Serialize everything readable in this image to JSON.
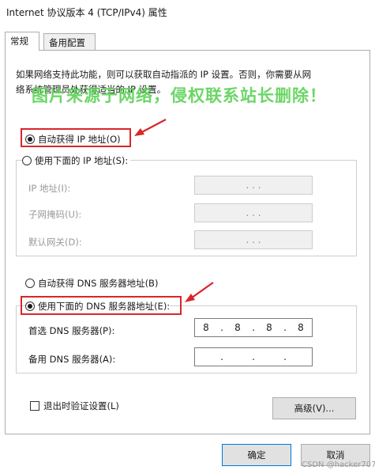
{
  "window": {
    "title": "Internet 协议版本 4 (TCP/IPv4) 属性"
  },
  "tabs": [
    {
      "label": "常规",
      "active": true
    },
    {
      "label": "备用配置",
      "active": false
    }
  ],
  "description": {
    "line1": "如果网络支持此功能，则可以获取自动指派的 IP 设置。否则，你需要从网",
    "line2": "络系统管理员处获得适当的 IP 设置。"
  },
  "watermark": "图片来源于网络，侵权联系站长删除！",
  "ip_section": {
    "auto_label": "自动获得 IP 地址(O)",
    "auto_selected": true,
    "manual_label": "使用下面的 IP 地址(S):",
    "manual_selected": false,
    "fields": [
      {
        "label": "IP 地址(I):",
        "value": ". . ."
      },
      {
        "label": "子网掩码(U):",
        "value": ". . ."
      },
      {
        "label": "默认网关(D):",
        "value": ". . ."
      }
    ]
  },
  "dns_section": {
    "auto_label": "自动获得 DNS 服务器地址(B)",
    "auto_selected": false,
    "manual_label": "使用下面的 DNS 服务器地址(E):",
    "manual_selected": true,
    "preferred": {
      "label": "首选 DNS 服务器(P):",
      "octets": [
        "8",
        "8",
        "8",
        "8"
      ]
    },
    "alternate": {
      "label": "备用 DNS 服务器(A):",
      "octets": [
        "",
        "",
        "",
        ""
      ]
    }
  },
  "validate_checkbox": {
    "label": "退出时验证设置(L)",
    "checked": false
  },
  "buttons": {
    "advanced": "高级(V)...",
    "ok": "确定",
    "cancel": "取消"
  },
  "credit": "CSDN @hacker707",
  "colors": {
    "highlight_border": "#d9262a",
    "watermark": "#5fd35a",
    "default_button_border": "#0078d7"
  }
}
